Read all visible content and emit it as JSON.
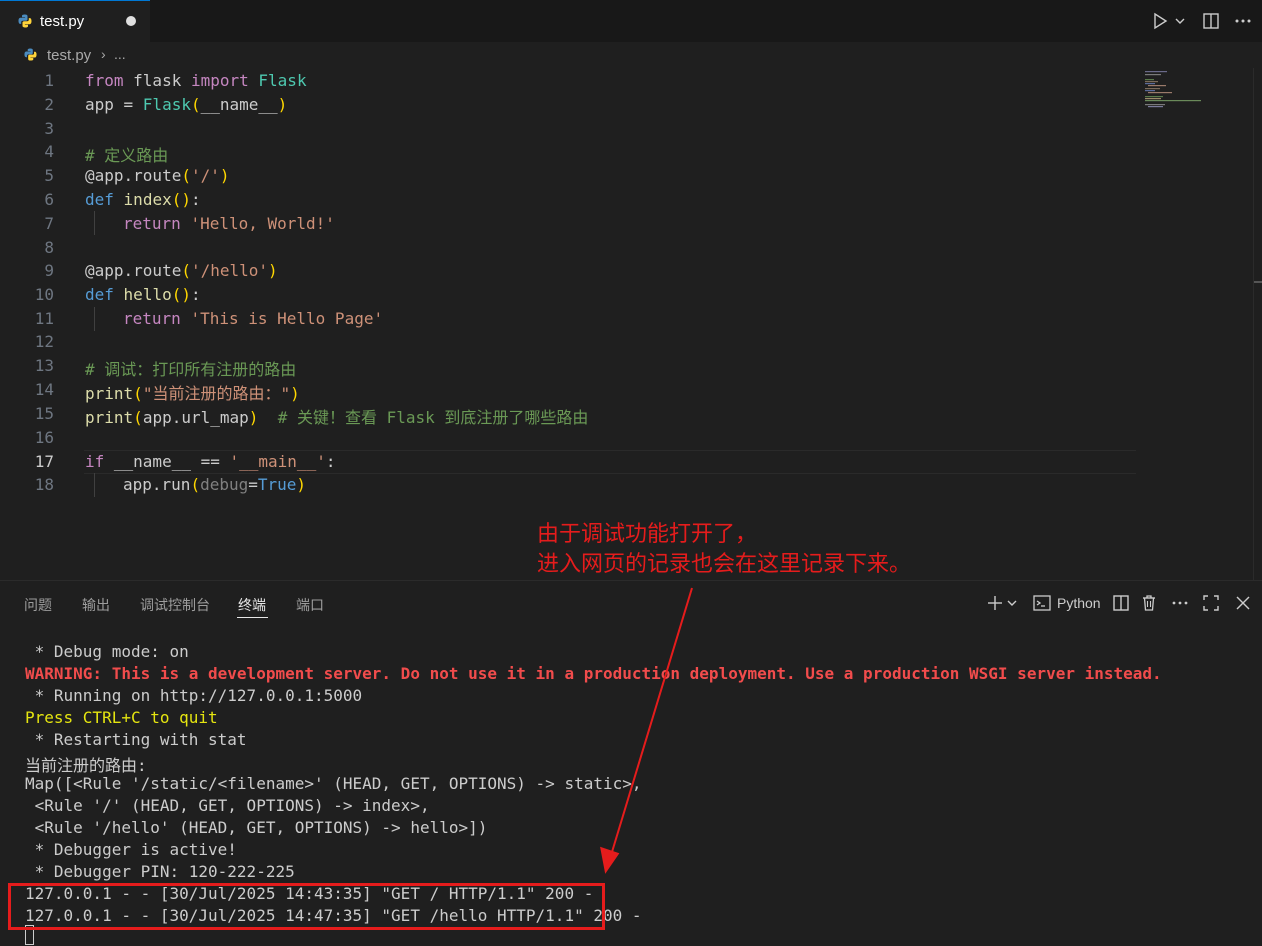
{
  "tab": {
    "filename": "test.py"
  },
  "breadcrumb": {
    "file": "test.py",
    "separator": "›",
    "ellipsis": "..."
  },
  "editor": {
    "line_numbers": [
      "1",
      "2",
      "3",
      "4",
      "5",
      "6",
      "7",
      "8",
      "9",
      "10",
      "11",
      "12",
      "13",
      "14",
      "15",
      "16",
      "17",
      "18"
    ],
    "line1": {
      "k1": "from",
      "t1": " flask ",
      "k2": "import",
      "t2": " ",
      "c1": "Flask"
    },
    "line2": {
      "t1": "app = ",
      "c1": "Flask",
      "b1": "(",
      "t2": "__name__",
      "b2": ")"
    },
    "line4": {
      "cm": "# 定义路由"
    },
    "line5": {
      "t1": "@app.route",
      "b1": "(",
      "s1": "'/'",
      "b2": ")"
    },
    "line6": {
      "k1": "def",
      "t1": " ",
      "f1": "index",
      "b1": "()",
      "t2": ":"
    },
    "line7": {
      "k1": "return",
      "t1": " ",
      "s1": "'Hello, World!'"
    },
    "line9": {
      "t1": "@app.route",
      "b1": "(",
      "s1": "'/hello'",
      "b2": ")"
    },
    "line10": {
      "k1": "def",
      "t1": " ",
      "f1": "hello",
      "b1": "()",
      "t2": ":"
    },
    "line11": {
      "k1": "return",
      "t1": " ",
      "s1": "'This is Hello Page'"
    },
    "line13": {
      "cm": "# 调试：打印所有注册的路由"
    },
    "line14": {
      "f1": "print",
      "b1": "(",
      "s1": "\"当前注册的路由：\"",
      "b2": ")"
    },
    "line15": {
      "f1": "print",
      "b1": "(",
      "t1": "app.url_map",
      "b2": ")",
      "t2": "  ",
      "cm": "# 关键！查看 Flask 到底注册了哪些路由"
    },
    "line17": {
      "k1": "if",
      "t1": " __name__ == ",
      "s1": "'__main__'",
      "t2": ":"
    },
    "line18": {
      "t1": "app.run",
      "b1": "(",
      "p1": "debug",
      "t2": "=",
      "k1": "True",
      "b2": ")"
    }
  },
  "annotation": {
    "line1": "由于调试功能打开了，",
    "line2": "进入网页的记录也会在这里记录下来。"
  },
  "panel": {
    "tabs": [
      "问题",
      "输出",
      "调试控制台",
      "终端",
      "端口"
    ],
    "active_tab": "终端",
    "terminal_label": "Python"
  },
  "terminal": {
    "l1": " * Debug mode: on",
    "l2": "WARNING: This is a development server. Do not use it in a production deployment. Use a production WSGI server instead.",
    "l3": " * Running on http://127.0.0.1:5000",
    "l4": "Press CTRL+C to quit",
    "l5": " * Restarting with stat",
    "l6": "当前注册的路由:",
    "l7": "Map([<Rule '/static/<filename>' (HEAD, GET, OPTIONS) -> static>,",
    "l8": " <Rule '/' (HEAD, GET, OPTIONS) -> index>,",
    "l9": " <Rule '/hello' (HEAD, GET, OPTIONS) -> hello>])",
    "l10": " * Debugger is active!",
    "l11": " * Debugger PIN: 120-222-225",
    "l12": "127.0.0.1 - - [30/Jul/2025 14:43:35] \"GET / HTTP/1.1\" 200 -",
    "l13": "127.0.0.1 - - [30/Jul/2025 14:47:35] \"GET /hello HTTP/1.1\" 200 -"
  },
  "colors": {
    "keyword": "#569cd6",
    "string": "#ce9178",
    "comment": "#6a9955",
    "class": "#4ec9b0",
    "function": "#dcdcaa",
    "bracket": "#ffd700",
    "annotation": "#e51c1c",
    "warning": "#f14c4c"
  },
  "icons": [
    "python-file-icon",
    "run-icon",
    "chevron-down-icon",
    "split-editor-icon",
    "more-icon",
    "add-terminal-icon",
    "terminal-icon",
    "split-terminal-icon",
    "trash-icon",
    "maximize-icon",
    "close-icon"
  ]
}
